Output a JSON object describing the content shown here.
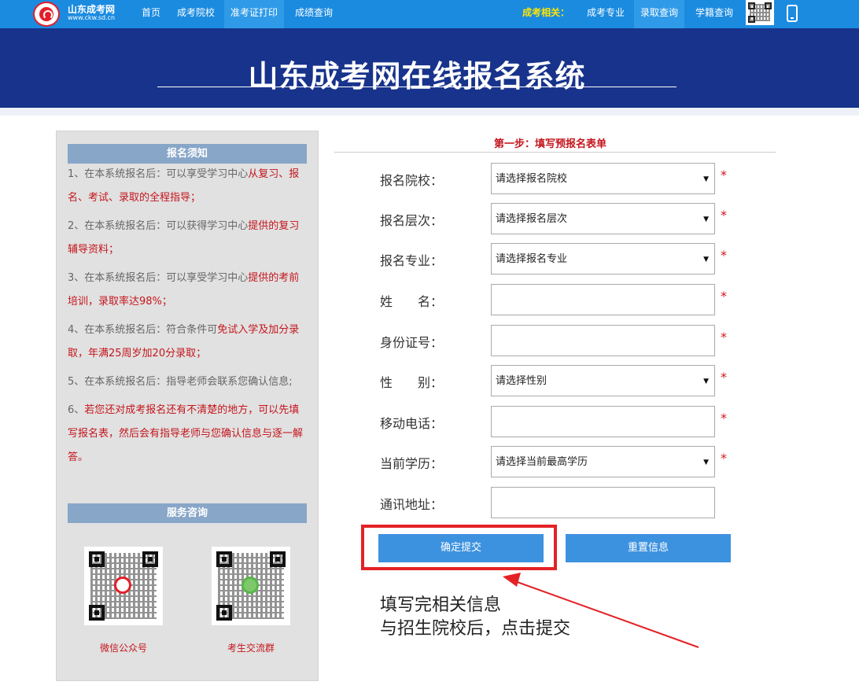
{
  "header": {
    "site_name": "山东成考网",
    "site_url": "www.ckw.sd.cn",
    "nav_left": [
      "首页",
      "成考院校",
      "准考证打印",
      "成绩查询"
    ],
    "related_label": "成考相关：",
    "nav_right": [
      "成考专业",
      "录取查询",
      "学籍查询"
    ]
  },
  "banner": {
    "title": "山东成考网在线报名系统"
  },
  "sidebar": {
    "notice_title": "报名须知",
    "notices": [
      {
        "plain": "1、在本系统报名后：可以享受学习中心",
        "highlight": "从复习、报名、考试、录取的全程指导；"
      },
      {
        "plain": "2、在本系统报名后：可以获得学习中心",
        "highlight": "提供的复习辅导资料；"
      },
      {
        "plain": "3、在本系统报名后：可以享受学习中心",
        "highlight": "提供的考前培训，录取率达98%；"
      },
      {
        "plain": "4、在本系统报名后：符合条件可",
        "highlight": "免试入学及加分录取，年满25周岁加20分录取；"
      },
      {
        "plain": "5、在本系统报名后：指导老师会联系您确认信息;",
        "highlight": ""
      },
      {
        "plain": "6、",
        "highlight": "若您还对成考报名还有不清楚的地方，可以先填写报名表，然后会有指导老师与您确认信息与逐一解答。"
      }
    ],
    "service_title": "服务咨询",
    "qr_labels": [
      "微信公众号",
      "考生交流群"
    ]
  },
  "form": {
    "step_title": "第一步：填写预报名表单",
    "fields": [
      {
        "label": "报名院校：",
        "type": "select",
        "value": "请选择报名院校",
        "required": true
      },
      {
        "label": "报名层次：",
        "type": "select",
        "value": "请选择报名层次",
        "required": true
      },
      {
        "label": "报名专业：",
        "type": "select",
        "value": "请选择报名专业",
        "required": true
      },
      {
        "label": "姓　　名：",
        "type": "text",
        "value": "",
        "required": true
      },
      {
        "label": "身份证号：",
        "type": "text",
        "value": "",
        "required": true
      },
      {
        "label": "性　　别：",
        "type": "select",
        "value": "请选择性别",
        "required": true
      },
      {
        "label": "移动电话：",
        "type": "text",
        "value": "",
        "required": true
      },
      {
        "label": "当前学历：",
        "type": "select",
        "value": "请选择当前最高学历",
        "required": true
      },
      {
        "label": "通讯地址：",
        "type": "text",
        "value": "",
        "required": false
      }
    ],
    "required_mark": "*",
    "submit_label": "确定提交",
    "reset_label": "重置信息"
  },
  "annotation": {
    "lines": [
      "填写完相关信息",
      "与招生院校后，点击提交"
    ],
    "color": "#e32226"
  }
}
